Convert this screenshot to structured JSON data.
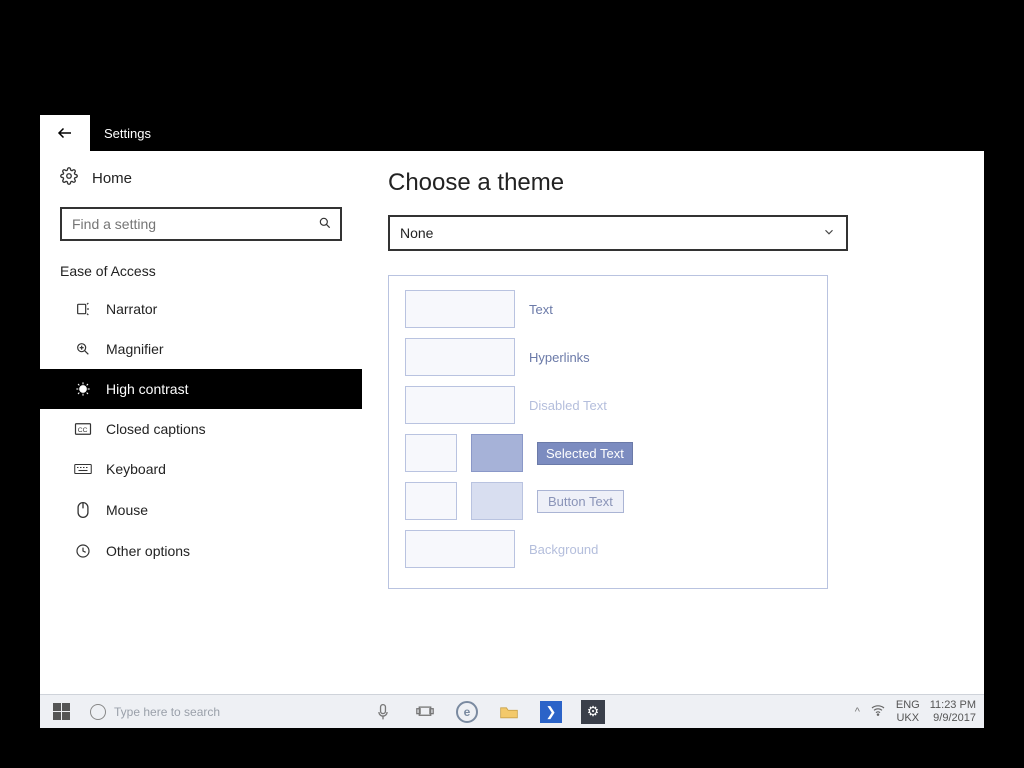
{
  "titlebar": {
    "title": "Settings"
  },
  "sidebar": {
    "home": "Home",
    "search_placeholder": "Find a setting",
    "section": "Ease of Access",
    "items": [
      {
        "label": "Narrator"
      },
      {
        "label": "Magnifier"
      },
      {
        "label": "High contrast"
      },
      {
        "label": "Closed captions"
      },
      {
        "label": "Keyboard"
      },
      {
        "label": "Mouse"
      },
      {
        "label": "Other options"
      }
    ]
  },
  "content": {
    "heading": "Choose a theme",
    "theme_selected": "None",
    "preview": {
      "text": "Text",
      "hyperlinks": "Hyperlinks",
      "disabled": "Disabled Text",
      "selected": "Selected Text",
      "button": "Button Text",
      "background": "Background"
    }
  },
  "taskbar": {
    "search_placeholder": "Type here to search",
    "lang1": "ENG",
    "lang2": "UKX",
    "time": "11:23 PM",
    "date": "9/9/2017"
  }
}
